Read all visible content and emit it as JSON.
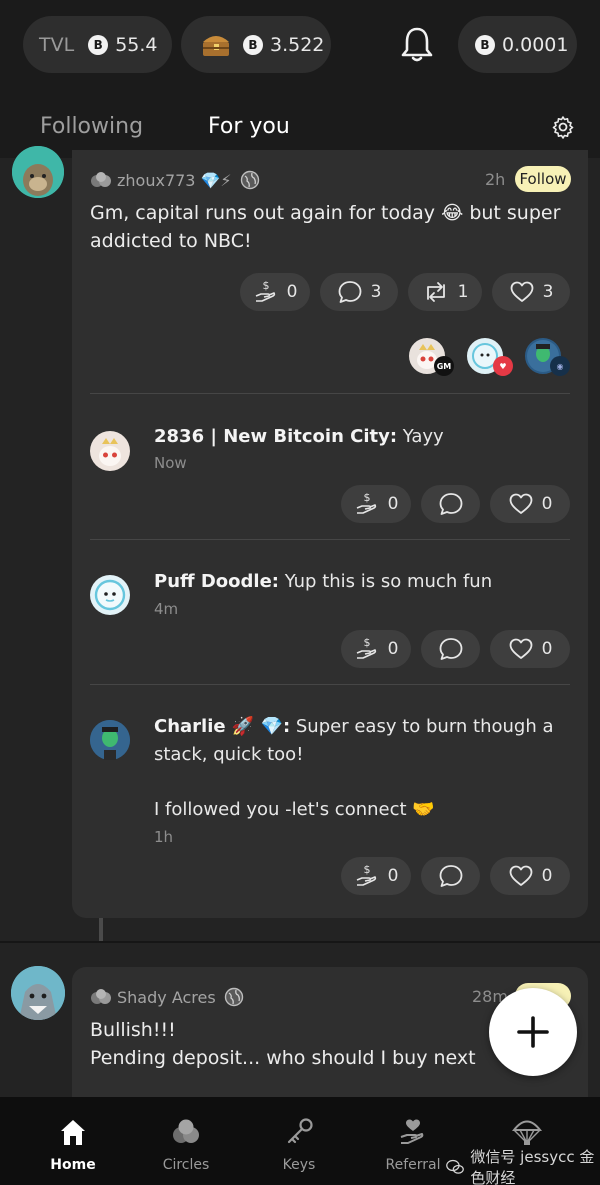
{
  "topbar": {
    "tvl_label": "TVL",
    "tvl_value": "55.4",
    "chest_value": "3.522",
    "balance_value": "0.0001",
    "btc_symbol": "B"
  },
  "tabs": [
    {
      "label": "Following",
      "active": false
    },
    {
      "label": "For you",
      "active": true
    }
  ],
  "posts": [
    {
      "author": "zhoux773",
      "badges": "💎⚡",
      "time": "2h",
      "follow_label": "Follow",
      "text_line1": "Gm, capital runs out again for today 😂 but super",
      "text_line2": "addicted to NBC!",
      "stats": {
        "tips": "0",
        "comments": "3",
        "reposts": "1",
        "likes": "3"
      },
      "reactor_badge": "GM",
      "replies": [
        {
          "author": "2836 | New Bitcoin City",
          "text": " Yayy",
          "time": "Now",
          "tips": "0",
          "likes": "0"
        },
        {
          "author": "Puff Doodle",
          "text": " Yup this is so much fun",
          "time": "4m",
          "tips": "0",
          "likes": "0"
        },
        {
          "author": "Charlie 🚀 💎",
          "text_line1": " Super easy to burn though a",
          "text_line2": "stack, quick too!",
          "text_line3": "I followed you -let's connect 🤝",
          "time": "1h",
          "tips": "0",
          "likes": "0"
        }
      ]
    },
    {
      "author": "Shady Acres",
      "time": "28m",
      "text_line1": "Bullish!!!",
      "text_line2": "Pending deposit... who should I buy next"
    }
  ],
  "nav": [
    {
      "label": "Home",
      "icon": "home-icon",
      "active": true
    },
    {
      "label": "Circles",
      "icon": "circles-icon",
      "active": false
    },
    {
      "label": "Keys",
      "icon": "key-icon",
      "active": false
    },
    {
      "label": "Referral",
      "icon": "referral-icon",
      "active": false
    },
    {
      "label": "",
      "icon": "airdrop-icon",
      "active": false
    }
  ],
  "watermark": "微信号 jessycc 金色财经",
  "colors": {
    "background": "#232323",
    "card": "#2f2f2f",
    "follow_badge": "#f7f1b6",
    "like_badge": "#e53945"
  }
}
